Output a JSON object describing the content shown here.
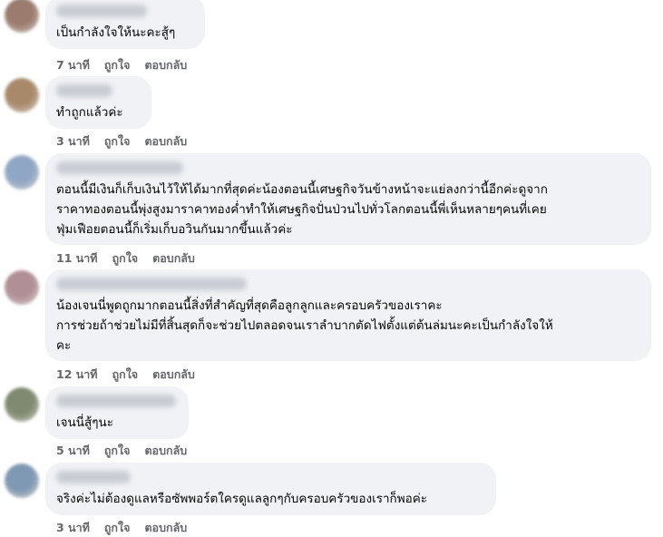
{
  "comments": [
    {
      "text": "เป็นกำลังใจให้นะคะสู้ๆ",
      "time": "7 นาที",
      "like": "ถูกใจ",
      "reply": "ตอบกลับ",
      "avatar_color": "#9a7b6e"
    },
    {
      "text": "ทำถูกแล้วค่ะ",
      "time": "3 นาที",
      "like": "ถูกใจ",
      "reply": "ตอบกลับ",
      "avatar_color": "#a8896a"
    },
    {
      "text": "ตอนนี้มีเงินก็เก็บเงินไว้ให้ได้มากที่สุดค่ะน้องตอนนี้เศษฐกิจวันข้างหน้าจะแย่ลงกว่านี้อีกค่ะดูจาก\nราคาทองตอนนี้พุ่งสูงมาราคาทองค่ำทำให้เศษฐกิจปั่นป่วนไปทั่วโลกตอนนี้พี่เห็นหลายๆคนที่เคย\nฟุ่มเฟือยตอนนี้ก็เริ่มเก็บอวินกันมากขึ้นแล้วค่ะ",
      "time": "11 นาที",
      "like": "ถูกใจ",
      "reply": "ตอบกลับ",
      "avatar_color": "#8fa6c4"
    },
    {
      "text": "น้องเจนนี่พูดถูกมากตอนนี้สิ่งที่สำคัญที่สุดคือลูกลูกและครอบครัวของเราคะ\nการช่วยถ้าช่วยไม่มีที่สิ้นสุดก็จะช่วยไปตลอดจนเราลำบากตัดไฟตั้งแต่ต้นล่มนะคะเป็นกำลังใจให้\nคะ",
      "time": "12 นาที",
      "like": "ถูกใจ",
      "reply": "ตอบกลับ",
      "avatar_color": "#b08f96"
    },
    {
      "text": "เจนนี่สู้ๆนะ",
      "time": "5 นาที",
      "like": "ถูกใจ",
      "reply": "ตอบกลับ",
      "avatar_color": "#7f8a70"
    },
    {
      "text": "จริงค่ะไม่ต้องดูแลหรือซัพพอร์ตใครดูแลลูกๆกับครอบครัวของเราก็พอค่ะ",
      "time": "3 นาที",
      "like": "ถูกใจ",
      "reply": "ตอบกลับ",
      "avatar_color": "#7f98b3"
    }
  ]
}
